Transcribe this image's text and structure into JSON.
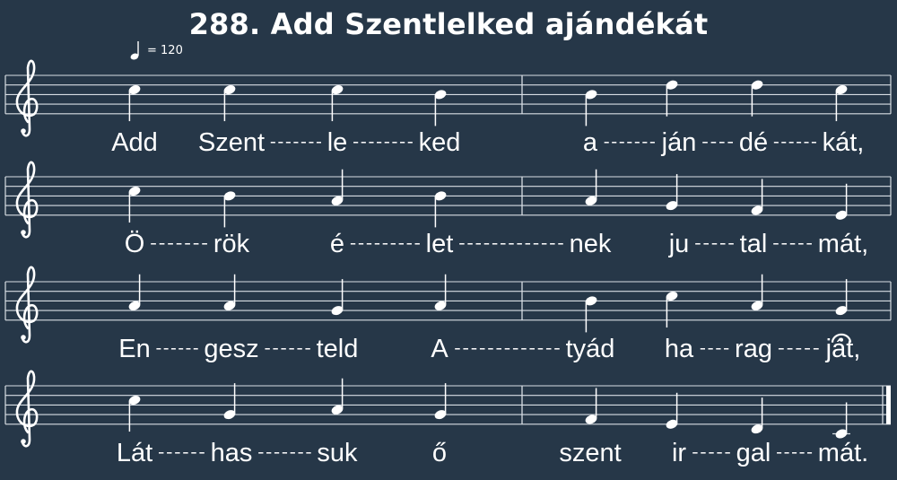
{
  "title": "288. Add Szentlelked ajándékát",
  "tempo": {
    "text": "= 120"
  },
  "colors": {
    "background": "#263748",
    "ink": "#ffffff",
    "staff_line": "#d8dee4"
  },
  "icons": [
    "treble-clef-icon",
    "quarter-note-icon",
    "fermata-icon",
    "final-barline"
  ],
  "systems": [
    {
      "notes": [
        "C5",
        "C5",
        "C5",
        "B4",
        "B4",
        "D5",
        "D5",
        "C5"
      ],
      "syllables": [
        "Add",
        "Szent",
        "le",
        "ked",
        "a",
        "ján",
        "dé",
        "kát,"
      ],
      "hyphens_after": [
        false,
        true,
        true,
        false,
        true,
        true,
        true,
        false
      ]
    },
    {
      "notes": [
        "C5",
        "B4",
        "A4",
        "B4",
        "A4",
        "G4",
        "F4",
        "E4"
      ],
      "syllables": [
        "Ö",
        "rök",
        "é",
        "let",
        "nek",
        "ju",
        "tal",
        "mát,"
      ],
      "hyphens_after": [
        true,
        false,
        true,
        true,
        false,
        true,
        true,
        false
      ]
    },
    {
      "notes": [
        "A4",
        "A4",
        "G4",
        "A4",
        "B4",
        "C5",
        "A4",
        "G4"
      ],
      "syllables": [
        "En",
        "gesz",
        "teld",
        "A",
        "tyád",
        "ha",
        "rag",
        "ját,"
      ],
      "hyphens_after": [
        true,
        true,
        false,
        true,
        false,
        true,
        true,
        false
      ],
      "fermata_on": 7
    },
    {
      "notes": [
        "C5",
        "G4",
        "A4",
        "G4",
        "F4",
        "E4",
        "D4",
        "C4"
      ],
      "syllables": [
        "Lát",
        "has",
        "suk",
        "ő",
        "szent",
        "ir",
        "gal",
        "mát."
      ],
      "hyphens_after": [
        true,
        true,
        false,
        false,
        false,
        true,
        true,
        false
      ],
      "final_barline": true
    }
  ]
}
